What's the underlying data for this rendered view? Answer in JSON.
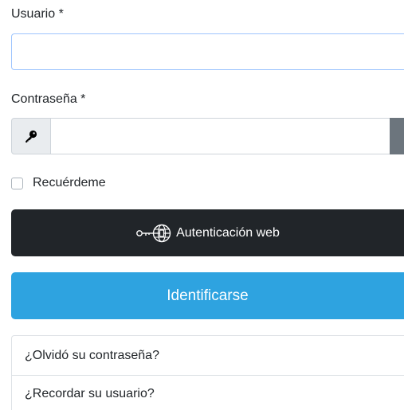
{
  "username": {
    "label": "Usuario *",
    "value": "",
    "placeholder": ""
  },
  "password": {
    "label": "Contraseña *",
    "value": "",
    "placeholder": ""
  },
  "remember": {
    "label": "Recuérdeme",
    "checked": false
  },
  "web_auth_button": {
    "label": "Autenticación web",
    "icon": "passkey-icon"
  },
  "login_button": {
    "label": "Identificarse"
  },
  "links": [
    {
      "label": "¿Olvidó su contraseña?"
    },
    {
      "label": "¿Recordar su usuario?"
    }
  ],
  "colors": {
    "primary_button": "#2ea3e0",
    "dark_button": "#212529",
    "focus_border": "#9ec5fe",
    "toggle_gray": "#6c757d"
  }
}
